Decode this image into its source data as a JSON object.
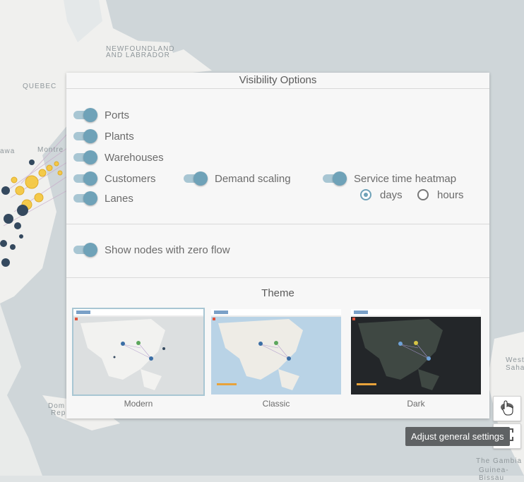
{
  "map": {
    "labels": [
      "NEWFOUNDLAND",
      "AND LABRADOR",
      "QUEBEC",
      "awa",
      "Montre",
      "West",
      "Saha",
      "Dom",
      "Repu",
      "The Gambia",
      "Guinea-Bissau"
    ]
  },
  "panel": {
    "title": "Visibility Options",
    "toggles": [
      {
        "label": "Ports",
        "on": true
      },
      {
        "label": "Plants",
        "on": true
      },
      {
        "label": "Warehouses",
        "on": true
      },
      {
        "label": "Customers",
        "on": true
      },
      {
        "label": "Lanes",
        "on": true
      }
    ],
    "demand_scaling": {
      "label": "Demand scaling",
      "on": true
    },
    "service_heatmap": {
      "label": "Service time heatmap",
      "on": true,
      "units": [
        {
          "label": "days",
          "checked": true
        },
        {
          "label": "hours",
          "checked": false
        }
      ]
    },
    "zero_flow": {
      "label": "Show nodes with zero flow",
      "on": true
    },
    "theme": {
      "title": "Theme",
      "options": [
        {
          "label": "Modern",
          "selected": true
        },
        {
          "label": "Classic",
          "selected": false
        },
        {
          "label": "Dark",
          "selected": false
        }
      ]
    }
  },
  "controls": {
    "settings_tooltip": "Adjust general settings"
  },
  "colors": {
    "accent": "#6fa2b8",
    "track": "#a8c6d3",
    "customer_nodes": "#f5c842",
    "plant_nodes": "#34495e"
  }
}
